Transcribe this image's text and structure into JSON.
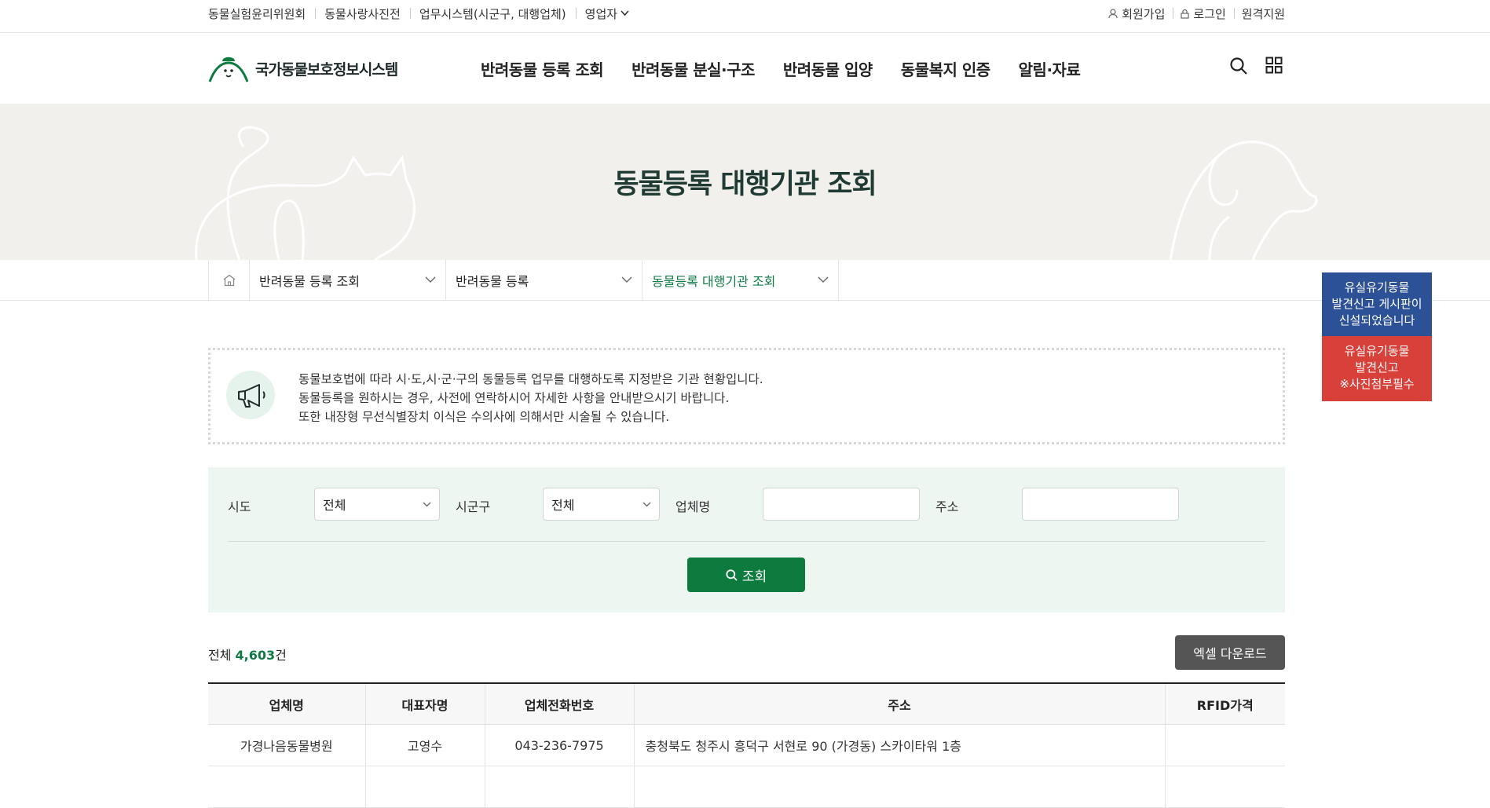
{
  "utility": {
    "left": [
      "동물실험윤리위원회",
      "동물사랑사진전",
      "업무시스템(시군구, 대행업체)",
      "영업자"
    ],
    "right": {
      "join": "회원가입",
      "login": "로그인",
      "remote": "원격지원"
    }
  },
  "logo": {
    "title": "국가동물보호정보시스템"
  },
  "gnb": [
    "반려동물 등록 조회",
    "반려동물 분실·구조",
    "반려동물 입양",
    "동물복지 인증",
    "알림·자료"
  ],
  "banner": {
    "title": "동물등록 대행기관 조회"
  },
  "breadcrumb": [
    "반려동물 등록 조회",
    "반려동물 등록",
    "동물등록 대행기관 조회"
  ],
  "quick": {
    "blue": [
      "유실유기동물",
      "발견신고 게시판이",
      "신설되었습니다"
    ],
    "red": [
      "유실유기동물",
      "발견신고",
      "※사진첨부필수"
    ]
  },
  "notice": {
    "lines": [
      "동물보호법에 따라 시·도,시·군·구의 동물등록 업무를 대행하도록 지정받은 기관 현황입니다.",
      "동물등록을 원하시는 경우, 사전에 연락하시어 자세한 사항을 안내받으시기 바랍니다.",
      "또한 내장형 무선식별장치 이식은 수의사에 의해서만 시술될 수 있습니다."
    ]
  },
  "search": {
    "sido_label": "시도",
    "sido_value": "전체",
    "sigungu_label": "시군구",
    "sigungu_value": "전체",
    "company_label": "업체명",
    "company_value": "",
    "address_label": "주소",
    "address_value": "",
    "button": "조회"
  },
  "total": {
    "prefix": "전체",
    "count": "4,603",
    "suffix": "건"
  },
  "excel_button": "엑셀 다운로드",
  "table": {
    "headers": [
      "업체명",
      "대표자명",
      "업체전화번호",
      "주소",
      "RFID가격"
    ],
    "rows": [
      [
        "가경나음동물병원",
        "고영수",
        "043-236-7975",
        "충청북도 청주시 흥덕구 서현로 90 (가경동) 스카이타워 1층",
        ""
      ]
    ]
  },
  "colors": {
    "brand_green": "#0d7a3e",
    "notice_blue": "#2d5196",
    "notice_red": "#d8403a"
  }
}
